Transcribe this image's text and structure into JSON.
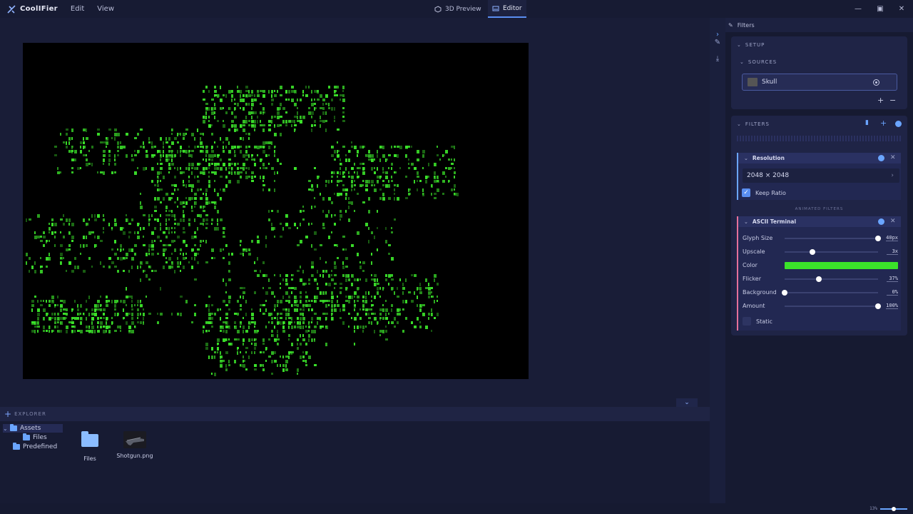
{
  "app": {
    "name": "CoolIFier",
    "menu": [
      "Edit",
      "View"
    ],
    "tabs": [
      {
        "label": "3D Preview",
        "icon": "cube-icon",
        "active": false
      },
      {
        "label": "Editor",
        "icon": "editor-icon",
        "active": true
      }
    ]
  },
  "explorer": {
    "title": "Explorer",
    "tree": [
      {
        "label": "Assets",
        "expanded": true,
        "selected": true
      },
      {
        "label": "Files",
        "child": true
      },
      {
        "label": "Predefined"
      }
    ],
    "files": [
      {
        "label": "Files",
        "type": "folder"
      },
      {
        "label": "Shotgun.png",
        "type": "image"
      }
    ]
  },
  "panel": {
    "title": "Filters",
    "setup": {
      "title": "Setup",
      "sources_title": "Sources",
      "source_name": "Skull",
      "add": "+",
      "remove": "−"
    },
    "filters": {
      "title": "Filters",
      "resolution": {
        "title": "Resolution",
        "value": "2048 × 2048",
        "keep_ratio_label": "Keep Ratio",
        "keep_ratio": true
      },
      "animated_label": "Animated Filters",
      "ascii": {
        "title": "ASCII Terminal",
        "rows": [
          {
            "name": "Glyph Size",
            "value": "40px",
            "level": 1.0
          },
          {
            "name": "Upscale",
            "value": "3x",
            "level": 0.3
          },
          {
            "name": "Flicker",
            "value": "37%",
            "level": 0.37
          },
          {
            "name": "Background",
            "value": "0%",
            "level": 0.0
          },
          {
            "name": "Amount",
            "value": "100%",
            "level": 1.0
          }
        ],
        "color_label": "Color",
        "color": "#3be32a",
        "static_label": "Static",
        "static": false
      }
    }
  },
  "status": {
    "zoom": "13%",
    "zoom_level": 0.5
  },
  "colors": {
    "accent": "#5a8ef0",
    "ascii_green": "#3be32a"
  }
}
